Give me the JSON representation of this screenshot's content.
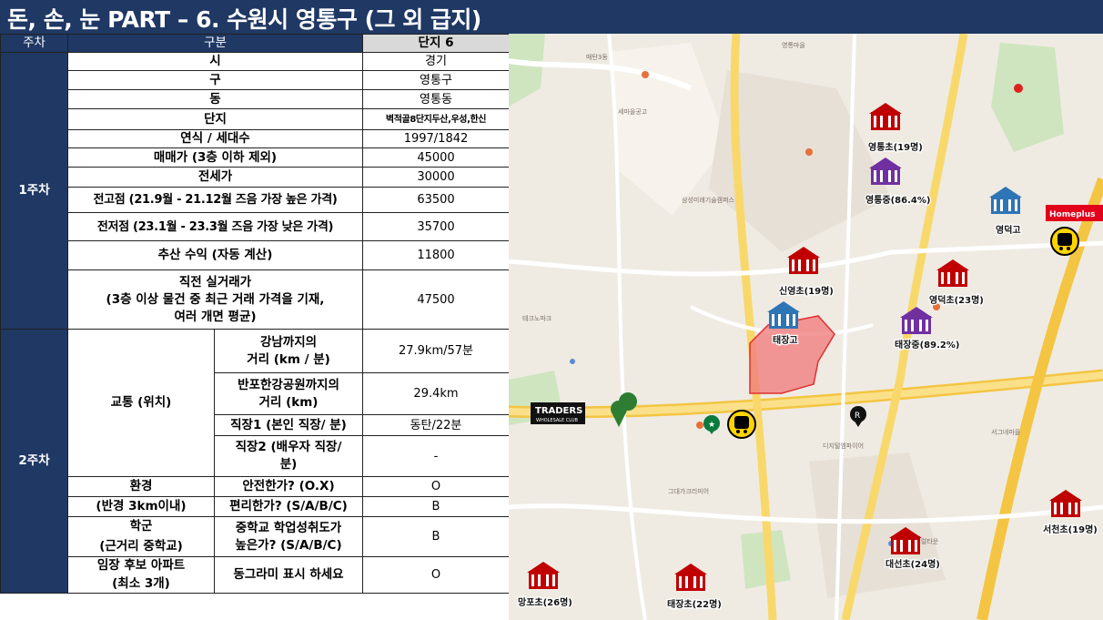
{
  "title": "돈, 손, 눈 PART – 6. 수원시 영통구 (그 외 급지)",
  "table": {
    "headers": {
      "week": "주차",
      "category": "구분",
      "complex": "단지 6"
    },
    "week1": "1주차",
    "week2": "2주차",
    "rows": {
      "si": {
        "label": "시",
        "value": "경기"
      },
      "gu": {
        "label": "구",
        "value": "영통구"
      },
      "dong": {
        "label": "동",
        "value": "영통동"
      },
      "danji": {
        "label": "단지",
        "value": "벽적골8단지두산,우성,한신"
      },
      "year": {
        "label": "연식 / 세대수",
        "value": "1997/1842"
      },
      "sale": {
        "label": "매매가 (3층 이하 제외)",
        "value": "45000"
      },
      "jeonse": {
        "label": "전세가",
        "value": "30000"
      },
      "high": {
        "label": "전고점 (21.9월 - 21.12월 즈음 가장 높은 가격)",
        "value": "63500"
      },
      "low": {
        "label": "전저점 (23.1월 - 23.3월 즈음 가장 낮은 가격)",
        "value": "35700"
      },
      "profit": {
        "label": "추산 수익 (자동 계산)",
        "value": "11800"
      },
      "recent": {
        "label1": "직전 실거래가",
        "label2": "(3층 이상 물건 중 최근 거래 가격을 기재,",
        "label3": "여러 개면 평균)",
        "value": "47500"
      },
      "transport": {
        "group": "교통 (위치)",
        "gangnam": {
          "label1": "강남까지의",
          "label2": "거리 (km / 분)",
          "value": "27.9km/57분"
        },
        "banpo": {
          "label1": "반포한강공원까지의",
          "label2": "거리 (km)",
          "value": "29.4km"
        },
        "job1": {
          "label": "직장1 (본인 직장/ 분)",
          "value": "동탄/22분"
        },
        "job2": {
          "label1": "직장2 (배우자 직장/",
          "label2": "분)",
          "value": "-"
        }
      },
      "env": {
        "group1": "환경",
        "group2": "(반경 3km이내)",
        "safe": {
          "label": "안전한가? (O.X)",
          "value": "O"
        },
        "convenient": {
          "label": "편리한가? (S/A/B/C)",
          "value": "B"
        }
      },
      "school": {
        "group1": "학군",
        "group2": "(근거리 중학교)",
        "label1": "중학교 학업성취도가",
        "label2": "높은가? (S/A/B/C)",
        "value": "B"
      },
      "candidate": {
        "group1": "임장 후보 아파트",
        "group2": "(최소 3개)",
        "label": "동그라미 표시 하세요",
        "value": "O"
      }
    }
  },
  "map": {
    "labels": {
      "yeongtong_elem": "영통초(19명)",
      "yeongtong_mid": "영통중(86.4%)",
      "yeongdeok_high": "영덕고",
      "sinyeong_elem": "신영초(19명)",
      "taejang_high": "태장고",
      "yeongdeok_elem": "영덕초(23명)",
      "taejang_mid": "태장중(89.2%)",
      "seocheon_elem": "서천초(19명)",
      "daeseon_elem": "대선초(24명)",
      "manpo_elem": "망포초(26명)",
      "taejang_elem": "태장초(22명)",
      "traders1": "TRADERS",
      "traders2": "WHOLESALE CLUB",
      "homeplus": "Homeplus"
    },
    "colors": {
      "title_bg": "#1f3864",
      "school_elem": "#c00000",
      "school_mid": "#7030a0",
      "school_high": "#2e75b6",
      "highlight": "#f08080"
    }
  }
}
